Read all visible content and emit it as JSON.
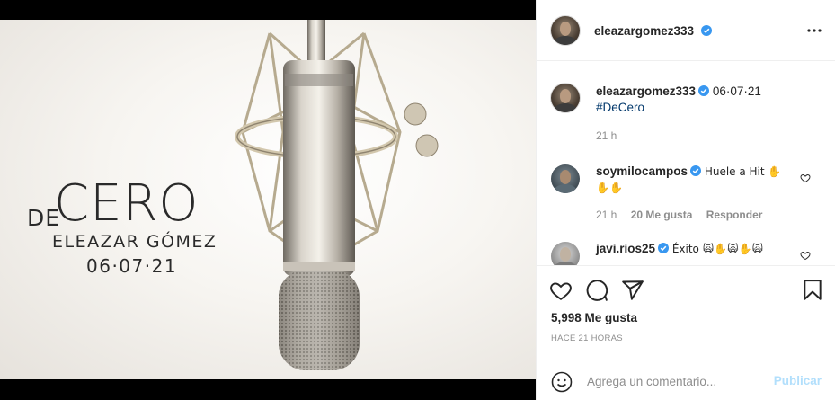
{
  "post": {
    "cover": {
      "de": "DE",
      "cero": "CERO",
      "artist": "ELEAZAR GÓMEZ",
      "date": "06·07·21"
    }
  },
  "header": {
    "username": "eleazargomez333",
    "more_icon": "more-horizontal-icon"
  },
  "caption": {
    "username": "eleazargomez333",
    "text": "06·07·21",
    "hashtag": "#DeCero",
    "time": "21 h"
  },
  "comments": [
    {
      "username": "soymilocampos",
      "text": "Huele a Hit ✋",
      "text2": "✋✋",
      "time": "21 h",
      "likes": "20 Me gusta",
      "reply": "Responder"
    },
    {
      "username": "javi.rios25",
      "text": "Éxito 🙀✋🙀✋🙀"
    }
  ],
  "actions": {
    "likes": "5,998 Me gusta",
    "ago": "HACE 21 HORAS"
  },
  "add_comment": {
    "placeholder": "Agrega un comentario...",
    "publish": "Publicar"
  },
  "colors": {
    "verified": "#3897f0",
    "hashtag": "#00376b",
    "publish": "#b2dffc",
    "muted": "#8e8e8e"
  }
}
